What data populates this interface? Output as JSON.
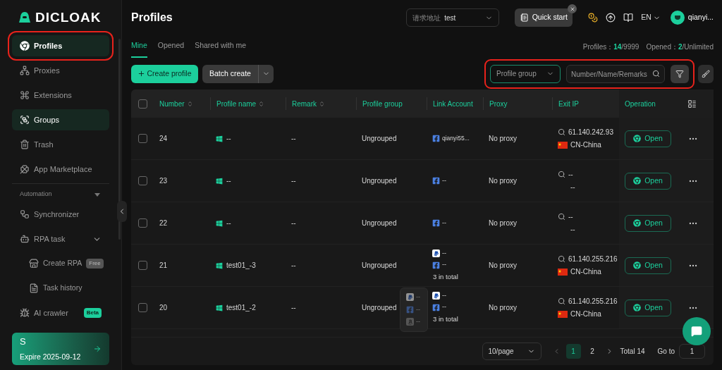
{
  "brand": {
    "name": "DICLOAK"
  },
  "sidebar": {
    "items": [
      {
        "label": "Profiles",
        "selected": true,
        "hovered": true,
        "highlighted": true
      },
      {
        "label": "Proxies",
        "selected": false,
        "hovered": false,
        "highlighted": false
      },
      {
        "label": "Extensions",
        "selected": false,
        "hovered": false,
        "highlighted": false
      },
      {
        "label": "Groups",
        "selected": false,
        "hovered": true,
        "highlighted": false
      },
      {
        "label": "Trash",
        "selected": false,
        "hovered": false,
        "highlighted": false
      },
      {
        "label": "App Marketplace",
        "selected": false,
        "hovered": false,
        "highlighted": false
      }
    ],
    "section": {
      "label": "Automation",
      "expanded": true,
      "items": [
        {
          "label": "Synchronizer"
        },
        {
          "label": "RPA task",
          "expanded": true,
          "children": [
            {
              "label": "Create RPA",
              "badge": {
                "text": "Free",
                "kind": "neutral"
              }
            },
            {
              "label": "Task history"
            }
          ]
        },
        {
          "label": "AI crawler",
          "badge": {
            "text": "Beta",
            "kind": "accent"
          }
        }
      ]
    },
    "plan": {
      "initial": "S",
      "expire": "Expire 2025-09-12"
    }
  },
  "header": {
    "title": "Profiles",
    "address_select": {
      "label": "请求地址",
      "value": "test"
    },
    "quick_start": "Quick start",
    "language": "EN",
    "user": "qianyi..."
  },
  "tabs": [
    {
      "label": "Mine",
      "selected": true
    },
    {
      "label": "Opened",
      "selected": false
    },
    {
      "label": "Shared with me",
      "selected": false
    }
  ],
  "stats": {
    "profiles_label": "Profiles：",
    "profiles_count": "14",
    "profiles_limit": "/9999",
    "opened_label": "Opened：",
    "opened_count": "2",
    "opened_limit": "/Unlimited"
  },
  "toolbar": {
    "create": "Create profile",
    "batch": "Batch create",
    "highlighted": true,
    "group_select": {
      "placeholder": "Profile group"
    },
    "search": {
      "placeholder": "Number/Name/Remarks"
    }
  },
  "table": {
    "header_checked": false,
    "columns": [
      {
        "label": "Number",
        "sortable": true
      },
      {
        "label": "Profile name",
        "sortable": true
      },
      {
        "label": "Remark",
        "sortable": true
      },
      {
        "label": "Profile group",
        "sortable": false
      },
      {
        "label": "Link Account",
        "sortable": false
      },
      {
        "label": "Proxy",
        "sortable": false
      },
      {
        "label": "Exit IP",
        "sortable": false
      },
      {
        "label": "Operation",
        "sortable": false
      }
    ],
    "rows": [
      {
        "number": "24",
        "checked": false,
        "name": "--",
        "remark": "--",
        "group": "Ungrouped",
        "accounts": [
          {
            "kind": "facebook",
            "text": "qianyi55..."
          }
        ],
        "proxy": "No proxy",
        "exit_ip": {
          "ip": "61.140.242.93",
          "has_flag": true,
          "country": "CN-China"
        },
        "action": "Open"
      },
      {
        "number": "23",
        "checked": false,
        "name": "--",
        "remark": "--",
        "group": "Ungrouped",
        "accounts": [
          {
            "kind": "facebook",
            "text": "--"
          }
        ],
        "proxy": "No proxy",
        "exit_ip": {
          "ip": "--",
          "has_flag": false,
          "country": "--"
        },
        "action": "Open"
      },
      {
        "number": "22",
        "checked": false,
        "name": "--",
        "remark": "--",
        "group": "Ungrouped",
        "accounts": [
          {
            "kind": "facebook",
            "text": "--"
          }
        ],
        "proxy": "No proxy",
        "exit_ip": {
          "ip": "--",
          "has_flag": false,
          "country": "--"
        },
        "action": "Open"
      },
      {
        "number": "21",
        "checked": false,
        "name": "test01_-3",
        "remark": "--",
        "group": "Ungrouped",
        "accounts": [
          {
            "kind": "paypal",
            "text": "--"
          },
          {
            "kind": "facebook",
            "text": "--"
          }
        ],
        "accounts_total": "3 in total",
        "popover": [
          {
            "kind": "paypal",
            "text": "--"
          },
          {
            "kind": "facebook",
            "text": "--"
          },
          {
            "kind": "amazon",
            "text": "--"
          }
        ],
        "proxy": "No proxy",
        "exit_ip": {
          "ip": "61.140.255.216",
          "has_flag": true,
          "country": "CN-China"
        },
        "action": "Open"
      },
      {
        "number": "20",
        "checked": false,
        "name": "test01_-2",
        "remark": "--",
        "group": "Ungrouped",
        "accounts": [
          {
            "kind": "paypal",
            "text": "--"
          },
          {
            "kind": "facebook",
            "text": "--"
          }
        ],
        "accounts_total": "3 in total",
        "proxy": "No proxy",
        "exit_ip": {
          "ip": "61.140.255.216",
          "has_flag": true,
          "country": "CN-China"
        },
        "action": "Open"
      }
    ]
  },
  "pagination": {
    "page_size": "10/page",
    "pages": [
      {
        "label": "1",
        "selected": true
      },
      {
        "label": "2",
        "selected": false
      }
    ],
    "total": "Total 14",
    "goto_label": "Go to",
    "goto_value": "1"
  }
}
